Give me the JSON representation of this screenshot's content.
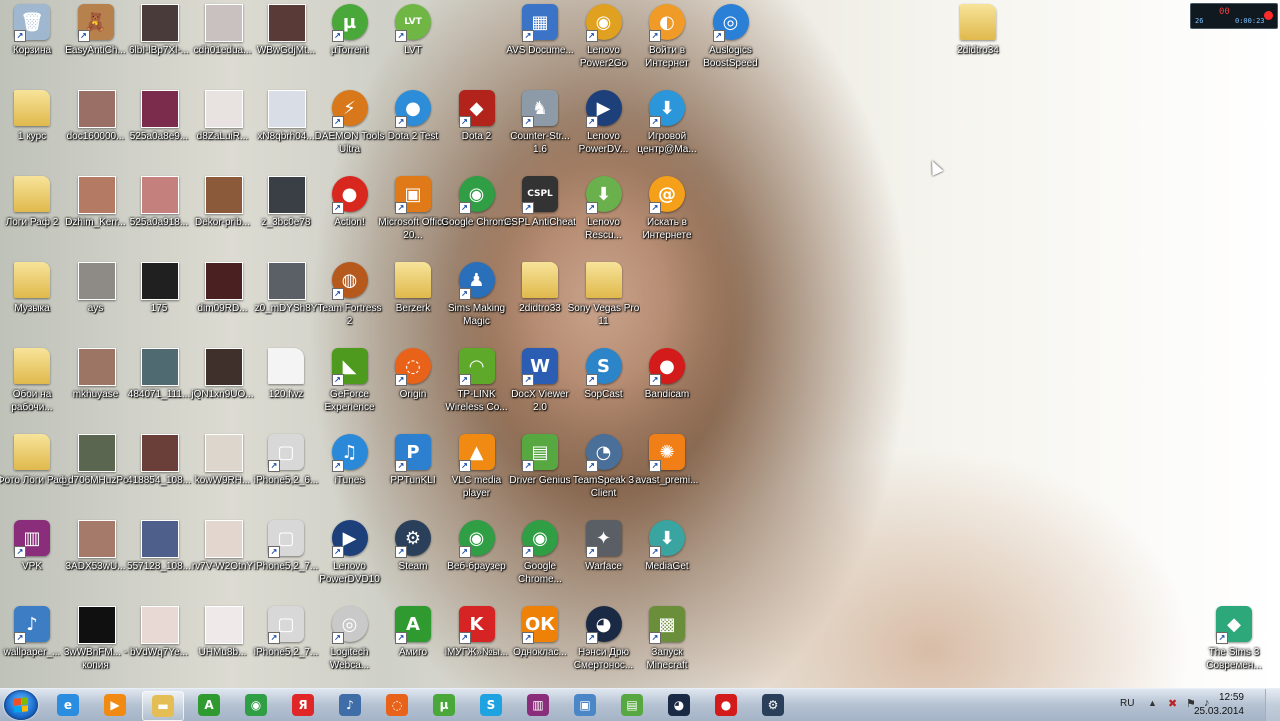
{
  "desktop_icons": [
    {
      "label": "Корзина",
      "glyph": "🗑",
      "color": "#9fb7cf",
      "name": "recycle-bin-icon",
      "x": 0,
      "y": 0
    },
    {
      "label": "EasyAntiCh...",
      "glyph": "🧸",
      "color": "#b7814e",
      "name": "teddy-bear-icon",
      "x": 1,
      "y": 0
    },
    {
      "label": "6lbI-lBp7Xl-...",
      "glyph": "",
      "color": "#4a3b3b",
      "name": "photo-thumbnail-icon",
      "x": 2,
      "y": 0,
      "kind": "photo"
    },
    {
      "label": "cdh01edua...",
      "glyph": "",
      "color": "#c9c0c0",
      "name": "photo-thumbnail-icon",
      "x": 3,
      "y": 0,
      "kind": "photo"
    },
    {
      "label": "WBwGdjMt...",
      "glyph": "",
      "color": "#5a3a36",
      "name": "photo-thumbnail-icon",
      "x": 4,
      "y": 0,
      "kind": "photo"
    },
    {
      "label": "µTorrent",
      "glyph": "µ",
      "color": "#4aa83a",
      "name": "utorrent-icon",
      "x": 5,
      "y": 0,
      "shape": "round"
    },
    {
      "label": "LVT",
      "glyph": "LVT",
      "color": "#6fb644",
      "name": "lvt-icon",
      "x": 6,
      "y": 0,
      "shape": "round"
    },
    {
      "label": "AVS Docume...",
      "glyph": "▦",
      "color": "#3b74c7",
      "name": "avs-document-icon",
      "x": 8,
      "y": 0
    },
    {
      "label": "Lenovo Power2Go",
      "glyph": "◉",
      "color": "#e0a020",
      "name": "disc-icon",
      "x": 9,
      "y": 0,
      "shape": "round"
    },
    {
      "label": "Войти в Интернет",
      "glyph": "◐",
      "color": "#f09a28",
      "name": "internet-login-icon",
      "x": 10,
      "y": 0,
      "shape": "round"
    },
    {
      "label": "Auslogics BoostSpeed",
      "glyph": "◎",
      "color": "#2a7fd6",
      "name": "auslogics-icon",
      "x": 11,
      "y": 0,
      "shape": "round"
    },
    {
      "label": "1 курс",
      "glyph": "",
      "color": "#e9c35a",
      "name": "folder-icon",
      "x": 0,
      "y": 1,
      "kind": "folder"
    },
    {
      "label": "doc160000...",
      "glyph": "",
      "color": "#9a6f66",
      "name": "photo-thumbnail-icon",
      "x": 1,
      "y": 1,
      "kind": "photo"
    },
    {
      "label": "525a0a8e9...",
      "glyph": "",
      "color": "#7b2b4b",
      "name": "photo-thumbnail-icon",
      "x": 2,
      "y": 1,
      "kind": "photo"
    },
    {
      "label": "d8ZaLuiR...",
      "glyph": "",
      "color": "#e8e2e0",
      "name": "photo-thumbnail-icon",
      "x": 3,
      "y": 1,
      "kind": "photo"
    },
    {
      "label": "xN8qbrh04...",
      "glyph": "",
      "color": "#d9dde6",
      "name": "photo-thumbnail-icon",
      "x": 4,
      "y": 1,
      "kind": "photo"
    },
    {
      "label": "DAEMON Tools Ultra",
      "glyph": "⚡",
      "color": "#d9781b",
      "name": "daemon-tools-icon",
      "x": 5,
      "y": 1,
      "shape": "round"
    },
    {
      "label": "Dota 2 Test",
      "glyph": "●",
      "color": "#2d8dd8",
      "name": "dota2-test-icon",
      "x": 6,
      "y": 1,
      "shape": "round"
    },
    {
      "label": "Dota 2",
      "glyph": "◆",
      "color": "#b2231b",
      "name": "dota2-icon",
      "x": 7,
      "y": 1
    },
    {
      "label": "Counter-Str... 1.6",
      "glyph": "♞",
      "color": "#8d9aa8",
      "name": "counter-strike-icon",
      "x": 8,
      "y": 1
    },
    {
      "label": "Lenovo PowerDV...",
      "glyph": "▶",
      "color": "#1d3f7a",
      "name": "power-dvd-icon",
      "x": 9,
      "y": 1,
      "shape": "round"
    },
    {
      "label": "Игровой центр@Ma...",
      "glyph": "⬇",
      "color": "#2b96d9",
      "name": "game-center-icon",
      "x": 10,
      "y": 1,
      "shape": "round"
    },
    {
      "label": "Логи Раф 2",
      "glyph": "",
      "color": "#e9c35a",
      "name": "folder-icon",
      "x": 0,
      "y": 2,
      "kind": "folder"
    },
    {
      "label": "Dzhim_Kerr...",
      "glyph": "",
      "color": "#b57a63",
      "name": "photo-thumbnail-icon",
      "x": 1,
      "y": 2,
      "kind": "photo"
    },
    {
      "label": "525a0a918...",
      "glyph": "",
      "color": "#c4807d",
      "name": "photo-thumbnail-icon",
      "x": 2,
      "y": 2,
      "kind": "photo"
    },
    {
      "label": "Dekor-prib...",
      "glyph": "",
      "color": "#8b5a3a",
      "name": "photo-thumbnail-icon",
      "x": 3,
      "y": 2,
      "kind": "photo"
    },
    {
      "label": "z_3bc0e78",
      "glyph": "",
      "color": "#3a3f45",
      "name": "photo-thumbnail-icon",
      "x": 4,
      "y": 2,
      "kind": "photo"
    },
    {
      "label": "Action!",
      "glyph": "●",
      "color": "#d8271e",
      "name": "action-icon",
      "x": 5,
      "y": 2,
      "shape": "round"
    },
    {
      "label": "Microsoft Office 20...",
      "glyph": "▣",
      "color": "#e07a18",
      "name": "ms-office-icon",
      "x": 6,
      "y": 2
    },
    {
      "label": "Google Chrome",
      "glyph": "◉",
      "color": "#2f9e44",
      "name": "chrome-icon",
      "x": 7,
      "y": 2,
      "shape": "round"
    },
    {
      "label": "CSPL AntiCheat",
      "glyph": "CSPL",
      "color": "#333",
      "name": "cspl-anticheat-icon",
      "x": 8,
      "y": 2
    },
    {
      "label": "Lenovo Rescu...",
      "glyph": "⬇",
      "color": "#6ab04c",
      "name": "lenovo-rescue-icon",
      "x": 9,
      "y": 2,
      "shape": "round"
    },
    {
      "label": "Искать в Интернете",
      "glyph": "@",
      "color": "#f5a01a",
      "name": "search-internet-icon",
      "x": 10,
      "y": 2,
      "shape": "round"
    },
    {
      "label": "Музыка",
      "glyph": "",
      "color": "#e9c35a",
      "name": "folder-icon",
      "x": 0,
      "y": 3,
      "kind": "folder"
    },
    {
      "label": "ays",
      "glyph": "",
      "color": "#8e8a86",
      "name": "photo-thumbnail-icon",
      "x": 1,
      "y": 3,
      "kind": "photo"
    },
    {
      "label": "175",
      "glyph": "",
      "color": "#202020",
      "name": "photo-thumbnail-icon",
      "x": 2,
      "y": 3,
      "kind": "photo"
    },
    {
      "label": "dim09RD...",
      "glyph": "",
      "color": "#4a2020",
      "name": "photo-thumbnail-icon",
      "x": 3,
      "y": 3,
      "kind": "photo"
    },
    {
      "label": "z0_mDYSh8Y",
      "glyph": "",
      "color": "#5b6066",
      "name": "photo-thumbnail-icon",
      "x": 4,
      "y": 3,
      "kind": "photo"
    },
    {
      "label": "Team Fortress 2",
      "glyph": "◍",
      "color": "#b5591d",
      "name": "team-fortress-icon",
      "x": 5,
      "y": 3,
      "shape": "round"
    },
    {
      "label": "Berzerk",
      "glyph": "",
      "color": "#e9c35a",
      "name": "folder-icon",
      "x": 6,
      "y": 3,
      "kind": "folder"
    },
    {
      "label": "Sims Making Magic",
      "glyph": "♟",
      "color": "#2a6fba",
      "name": "sims-making-magic-icon",
      "x": 7,
      "y": 3,
      "shape": "round"
    },
    {
      "label": "2didtro33",
      "glyph": "",
      "color": "#e9c35a",
      "name": "folder-icon",
      "x": 8,
      "y": 3,
      "kind": "folder"
    },
    {
      "label": "Sony Vegas Pro 11",
      "glyph": "",
      "color": "#e9c35a",
      "name": "folder-icon",
      "x": 9,
      "y": 3,
      "kind": "folder"
    },
    {
      "label": "Обои на рабочи...",
      "glyph": "",
      "color": "#e9c35a",
      "name": "folder-icon",
      "x": 0,
      "y": 4,
      "kind": "folder"
    },
    {
      "label": "mkhuyase",
      "glyph": "",
      "color": "#9c7565",
      "name": "photo-thumbnail-icon",
      "x": 1,
      "y": 4,
      "kind": "photo"
    },
    {
      "label": "484071_111...",
      "glyph": "",
      "color": "#506a72",
      "name": "photo-thumbnail-icon",
      "x": 2,
      "y": 4,
      "kind": "photo"
    },
    {
      "label": "jQN1xn9UO...",
      "glyph": "",
      "color": "#40302b",
      "name": "photo-thumbnail-icon",
      "x": 3,
      "y": 4,
      "kind": "photo"
    },
    {
      "label": "120.fwz",
      "glyph": "",
      "color": "#f0f0f0",
      "name": "file-icon",
      "x": 4,
      "y": 4,
      "kind": "file"
    },
    {
      "label": "GeForce Experience",
      "glyph": "◣",
      "color": "#4e9a1e",
      "name": "geforce-icon",
      "x": 5,
      "y": 4
    },
    {
      "label": "Origin",
      "glyph": "◌",
      "color": "#e8621a",
      "name": "origin-icon",
      "x": 6,
      "y": 4,
      "shape": "round"
    },
    {
      "label": "TP-LINK Wireless Co...",
      "glyph": "◠",
      "color": "#5ea82a",
      "name": "tplink-icon",
      "x": 7,
      "y": 4
    },
    {
      "label": "DocX Viewer 2.0",
      "glyph": "W",
      "color": "#2b5eb3",
      "name": "docx-viewer-icon",
      "x": 8,
      "y": 4
    },
    {
      "label": "SopCast",
      "glyph": "S",
      "color": "#2c84c9",
      "name": "sopcast-icon",
      "x": 9,
      "y": 4,
      "shape": "round"
    },
    {
      "label": "Bandicam",
      "glyph": "●",
      "color": "#d41b1b",
      "name": "bandicam-icon",
      "x": 10,
      "y": 4,
      "shape": "round"
    },
    {
      "label": "Фото Логи Раф",
      "glyph": "",
      "color": "#e9c35a",
      "name": "folder-icon",
      "x": 0,
      "y": 5,
      "kind": "folder"
    },
    {
      "label": "_d706MHuzPo",
      "glyph": "",
      "color": "#5a6650",
      "name": "photo-thumbnail-icon",
      "x": 1,
      "y": 5,
      "kind": "photo"
    },
    {
      "label": "418854_108...",
      "glyph": "",
      "color": "#6a3f3a",
      "name": "photo-thumbnail-icon",
      "x": 2,
      "y": 5,
      "kind": "photo"
    },
    {
      "label": "kowW9RH...",
      "glyph": "",
      "color": "#dcd6cc",
      "name": "photo-thumbnail-icon",
      "x": 3,
      "y": 5,
      "kind": "photo"
    },
    {
      "label": "iPhone5,2_6...",
      "glyph": "▢",
      "color": "#d8d8d8",
      "name": "ipsw-file-icon",
      "x": 4,
      "y": 5
    },
    {
      "label": "iTunes",
      "glyph": "♫",
      "color": "#2a8ad9",
      "name": "itunes-icon",
      "x": 5,
      "y": 5,
      "shape": "round"
    },
    {
      "label": "PPTunKLI",
      "glyph": "P",
      "color": "#2d7fd0",
      "name": "pptv-icon",
      "x": 6,
      "y": 5
    },
    {
      "label": "VLC media player",
      "glyph": "▲",
      "color": "#f08a12",
      "name": "vlc-icon",
      "x": 7,
      "y": 5
    },
    {
      "label": "Driver Genius",
      "glyph": "▤",
      "color": "#58a842",
      "name": "driver-genius-icon",
      "x": 8,
      "y": 5
    },
    {
      "label": "TeamSpeak 3 Client",
      "glyph": "◔",
      "color": "#4a6f99",
      "name": "teamspeak-icon",
      "x": 9,
      "y": 5,
      "shape": "round"
    },
    {
      "label": "avast_premi...",
      "glyph": "✺",
      "color": "#f07f17",
      "name": "avast-icon",
      "x": 10,
      "y": 5
    },
    {
      "label": "VPK",
      "glyph": "▥",
      "color": "#8a2d7a",
      "name": "winrar-icon",
      "x": 0,
      "y": 6
    },
    {
      "label": "3ADX53wU...",
      "glyph": "",
      "color": "#a67a6a",
      "name": "photo-thumbnail-icon",
      "x": 1,
      "y": 6,
      "kind": "photo"
    },
    {
      "label": "557128_108...",
      "glyph": "",
      "color": "#4d5f8a",
      "name": "photo-thumbnail-icon",
      "x": 2,
      "y": 6,
      "kind": "photo"
    },
    {
      "label": "rv7V-W2OtnY",
      "glyph": "",
      "color": "#e2d6cf",
      "name": "photo-thumbnail-icon",
      "x": 3,
      "y": 6,
      "kind": "photo"
    },
    {
      "label": "iPhone5,2_7...",
      "glyph": "▢",
      "color": "#d8d8d8",
      "name": "ipsw-file-icon",
      "x": 4,
      "y": 6
    },
    {
      "label": "Lenovo PowerDVD10",
      "glyph": "▶",
      "color": "#1d3f7a",
      "name": "power-dvd-icon",
      "x": 5,
      "y": 6,
      "shape": "round"
    },
    {
      "label": "Steam",
      "glyph": "⚙",
      "color": "#2a3f5a",
      "name": "steam-icon",
      "x": 6,
      "y": 6,
      "shape": "round"
    },
    {
      "label": "Веб-браузер",
      "glyph": "◉",
      "color": "#2f9e44",
      "name": "chrome-icon",
      "x": 7,
      "y": 6,
      "shape": "round"
    },
    {
      "label": "Google Chrome...",
      "glyph": "◉",
      "color": "#2f9e44",
      "name": "chrome-icon",
      "x": 8,
      "y": 6,
      "shape": "round"
    },
    {
      "label": "Warface",
      "glyph": "✦",
      "color": "#5a5f66",
      "name": "warface-icon",
      "x": 9,
      "y": 6
    },
    {
      "label": "MediaGet",
      "glyph": "⬇",
      "color": "#3aa5a0",
      "name": "mediaget-icon",
      "x": 10,
      "y": 6,
      "shape": "round"
    },
    {
      "label": "wallpaper_...",
      "glyph": "♪",
      "color": "#3d7dc4",
      "name": "mp3-file-icon",
      "x": 0,
      "y": 7
    },
    {
      "label": "3wWBnFM... - копия",
      "glyph": "",
      "color": "#101010",
      "name": "photo-thumbnail-icon",
      "x": 1,
      "y": 7,
      "kind": "photo"
    },
    {
      "label": "bVdWq7Ye...",
      "glyph": "",
      "color": "#e9d9d4",
      "name": "photo-thumbnail-icon",
      "x": 2,
      "y": 7,
      "kind": "photo"
    },
    {
      "label": "UHMu8b...",
      "glyph": "",
      "color": "#efe9ea",
      "name": "photo-thumbnail-icon",
      "x": 3,
      "y": 7,
      "kind": "photo"
    },
    {
      "label": "iPhone5,2_7...",
      "glyph": "▢",
      "color": "#d8d8d8",
      "name": "ipsw-file-icon",
      "x": 4,
      "y": 7
    },
    {
      "label": "Logitech Webca...",
      "glyph": "◎",
      "color": "#c9c9c9",
      "name": "logitech-webcam-icon",
      "x": 5,
      "y": 7,
      "shape": "round"
    },
    {
      "label": "Амиго",
      "glyph": "A",
      "color": "#2e9a30",
      "name": "amigo-icon",
      "x": 6,
      "y": 7
    },
    {
      "label": "іМУГЖ»№ы...",
      "glyph": "K",
      "color": "#d62323",
      "name": "kaspersky-icon",
      "x": 7,
      "y": 7
    },
    {
      "label": "Одноклас...",
      "glyph": "ОК",
      "color": "#ee8208",
      "name": "odnoklassniki-icon",
      "x": 8,
      "y": 7
    },
    {
      "label": "Нэнси Дрю Смертонос...",
      "glyph": "◕",
      "color": "#1b2a44",
      "name": "nancy-drew-icon",
      "x": 9,
      "y": 7,
      "shape": "round"
    },
    {
      "label": "Запуск Minecraft",
      "glyph": "▩",
      "color": "#6b8e3a",
      "name": "minecraft-icon",
      "x": 10,
      "y": 7
    },
    {
      "label": "2didtro34",
      "glyph": "",
      "color": "#e9c35a",
      "name": "folder-icon",
      "x": "right-top",
      "y": 0,
      "kind": "folder"
    },
    {
      "label": "The Sims 3 Современ...",
      "glyph": "◆",
      "color": "#2ca87a",
      "name": "sims3-icon",
      "x": "right-bottom",
      "y": 7
    }
  ],
  "taskbar": {
    "start_label": "Пуск",
    "buttons": [
      {
        "name": "internet-explorer-icon",
        "glyph": "e",
        "color": "#2b8de0"
      },
      {
        "name": "media-player-icon",
        "glyph": "▶",
        "color": "#f08a12"
      },
      {
        "name": "explorer-folder-icon",
        "glyph": "▬",
        "color": "#e4be54",
        "active": true
      },
      {
        "name": "amigo-taskbar-icon",
        "glyph": "A",
        "color": "#2e9a30"
      },
      {
        "name": "chrome-taskbar-icon",
        "glyph": "◉",
        "color": "#2f9e44"
      },
      {
        "name": "yandex-taskbar-icon",
        "glyph": "Я",
        "color": "#e02626"
      },
      {
        "name": "volume-mixer-icon",
        "glyph": "♪",
        "color": "#3e6da8"
      },
      {
        "name": "origin-taskbar-icon",
        "glyph": "◌",
        "color": "#e8621a"
      },
      {
        "name": "utorrent-taskbar-icon",
        "glyph": "µ",
        "color": "#4aa83a"
      },
      {
        "name": "skype-taskbar-icon",
        "glyph": "S",
        "color": "#1fa3e0"
      },
      {
        "name": "winrar-taskbar-icon",
        "glyph": "▥",
        "color": "#8a2d7a"
      },
      {
        "name": "remote-desktop-icon",
        "glyph": "▣",
        "color": "#4b86c7"
      },
      {
        "name": "driver-genius-taskbar-icon",
        "glyph": "▤",
        "color": "#58a842"
      },
      {
        "name": "nancy-drew-taskbar-icon",
        "glyph": "◕",
        "color": "#1b2a44"
      },
      {
        "name": "bandicam-taskbar-icon",
        "glyph": "●",
        "color": "#d41b1b"
      },
      {
        "name": "steam-taskbar-icon",
        "glyph": "⚙",
        "color": "#2a3f5a"
      }
    ],
    "tray": {
      "language": "RU",
      "time": "12:59",
      "date": "25.03.2014"
    }
  },
  "gadget": {
    "fps": "00",
    "frames": "26",
    "timer": "0:00:23"
  }
}
